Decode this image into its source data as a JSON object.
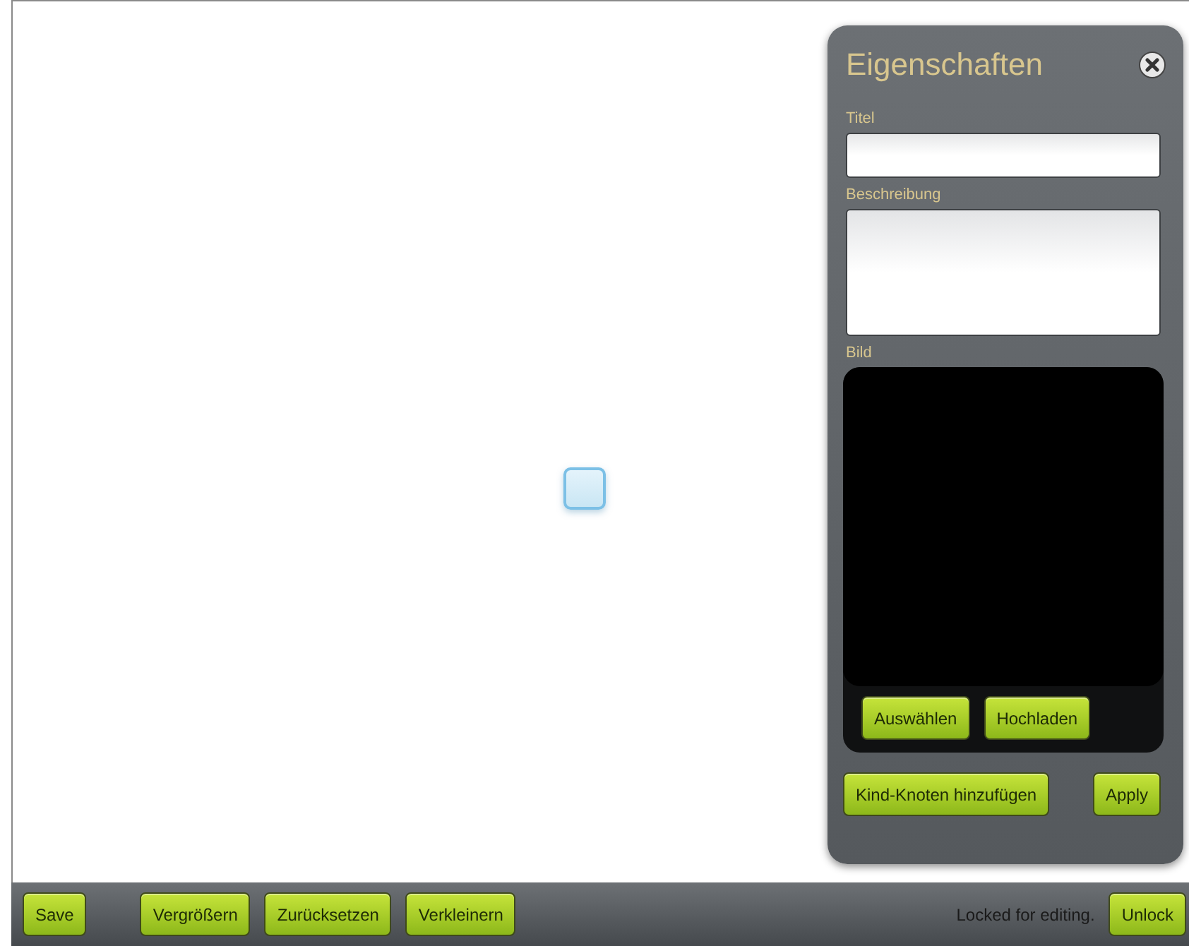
{
  "canvas": {
    "nodes": [
      {
        "kind": "box"
      }
    ]
  },
  "panel": {
    "title": "Eigenschaften",
    "fields": [
      {
        "label": "Titel",
        "kind": "line"
      },
      {
        "label": "Beschreibung",
        "kind": "area"
      }
    ],
    "image": {
      "label": "Bild",
      "buttons": [
        "Auswählen",
        "Hochladen"
      ]
    },
    "buttons": [
      "Kind-Knoten hinzufügen",
      "Apply"
    ]
  },
  "toolbar": {
    "buttons": [
      "Save",
      "Vergrößern",
      "Zurücksetzen",
      "Verkleinern"
    ],
    "status": "Locked for editing.",
    "action": "Unlock"
  }
}
